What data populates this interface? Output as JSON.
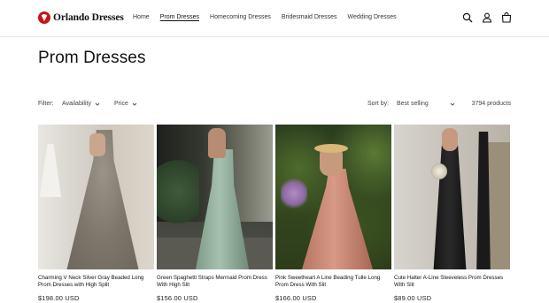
{
  "header": {
    "logo_text": "Orlando Dresses",
    "nav": [
      {
        "label": "Home",
        "active": false
      },
      {
        "label": "Prom Dresses",
        "active": true
      },
      {
        "label": "Homecoming Dresses",
        "active": false
      },
      {
        "label": "Bridesmaid Dresses",
        "active": false
      },
      {
        "label": "Wedding Dresses",
        "active": false
      }
    ],
    "icons": [
      "search-icon",
      "account-icon",
      "cart-icon"
    ]
  },
  "page": {
    "title": "Prom Dresses"
  },
  "filters": {
    "label": "Filter:",
    "availability": "Availability",
    "price": "Price",
    "sort_label": "Sort by:",
    "sort_value": "Best selling",
    "product_count": "3794 products"
  },
  "products": [
    {
      "title": "Charming V Neck Silver Gray Beaded Long Prom Dresses with High Split",
      "price": "$198.00 USD"
    },
    {
      "title": "Green Spaghetti Straps Mermaid Prom Dress With High Slit",
      "price": "$156.00 USD"
    },
    {
      "title": "Pink Sweetheart A Line Beading Tulle Long Prom Dress With Slit",
      "price": "$166.00 USD"
    },
    {
      "title": "Cute Halter A-Line Sleeveless Prom Dresses With Slit",
      "price": "$89.00 USD"
    }
  ],
  "colors": {
    "logo_accent": "#c4161c",
    "text": "#121212"
  }
}
